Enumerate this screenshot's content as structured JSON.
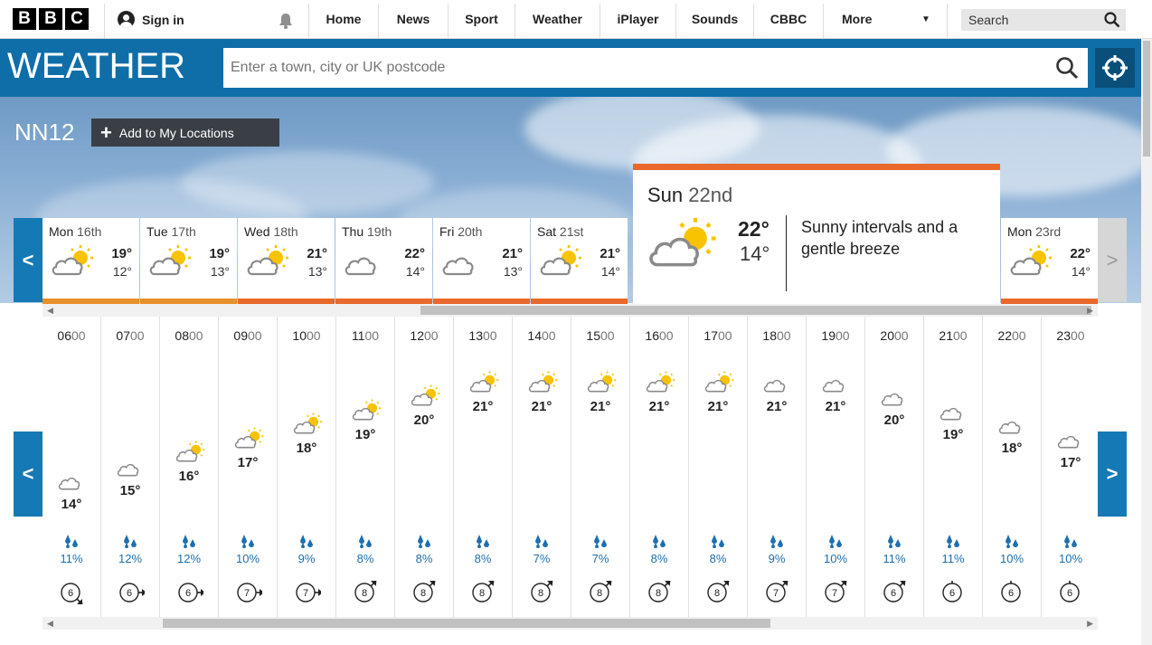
{
  "nav": {
    "logo_letters": [
      "B",
      "B",
      "C"
    ],
    "signin": "Sign in",
    "items": [
      "Home",
      "News",
      "Sport",
      "Weather",
      "iPlayer",
      "Sounds",
      "CBBC",
      "More"
    ],
    "search_placeholder": "Search"
  },
  "weather": {
    "title": "WEATHER",
    "search_placeholder": "Enter a town, city or UK postcode",
    "location": "NN12",
    "add_location": "Add to My Locations"
  },
  "days": [
    {
      "day": "Mon",
      "date": "16th",
      "hi": "19°",
      "lo": "12°",
      "icon": "sunny-intervals-icon"
    },
    {
      "day": "Tue",
      "date": "17th",
      "hi": "19°",
      "lo": "13°",
      "icon": "sunny-intervals-icon"
    },
    {
      "day": "Wed",
      "date": "18th",
      "hi": "21°",
      "lo": "13°",
      "icon": "sunny-intervals-icon"
    },
    {
      "day": "Thu",
      "date": "19th",
      "hi": "22°",
      "lo": "14°",
      "icon": "cloud-icon"
    },
    {
      "day": "Fri",
      "date": "20th",
      "hi": "21°",
      "lo": "13°",
      "icon": "cloud-icon"
    },
    {
      "day": "Sat",
      "date": "21st",
      "hi": "21°",
      "lo": "14°",
      "icon": "sunny-intervals-icon"
    }
  ],
  "selected_day": {
    "day": "Sun",
    "date": "22nd",
    "hi": "22°",
    "lo": "14°",
    "description": "Sunny intervals and a gentle breeze"
  },
  "next_day": {
    "day": "Mon",
    "date": "23rd",
    "hi": "22°",
    "lo": "14°"
  },
  "hours": [
    {
      "hh": "06",
      "mm": "00",
      "temp": "14°",
      "icon": "cloud",
      "rain": "11%",
      "wind": "6",
      "dir": "se"
    },
    {
      "hh": "07",
      "mm": "00",
      "temp": "15°",
      "icon": "cloud",
      "rain": "12%",
      "wind": "6",
      "dir": "e"
    },
    {
      "hh": "08",
      "mm": "00",
      "temp": "16°",
      "icon": "sun",
      "rain": "12%",
      "wind": "6",
      "dir": "e"
    },
    {
      "hh": "09",
      "mm": "00",
      "temp": "17°",
      "icon": "sun",
      "rain": "10%",
      "wind": "7",
      "dir": "e"
    },
    {
      "hh": "10",
      "mm": "00",
      "temp": "18°",
      "icon": "sun",
      "rain": "9%",
      "wind": "7",
      "dir": "e"
    },
    {
      "hh": "11",
      "mm": "00",
      "temp": "19°",
      "icon": "sun",
      "rain": "8%",
      "wind": "8",
      "dir": "ne"
    },
    {
      "hh": "12",
      "mm": "00",
      "temp": "20°",
      "icon": "sun",
      "rain": "8%",
      "wind": "8",
      "dir": "ne"
    },
    {
      "hh": "13",
      "mm": "00",
      "temp": "21°",
      "icon": "sun",
      "rain": "8%",
      "wind": "8",
      "dir": "ne"
    },
    {
      "hh": "14",
      "mm": "00",
      "temp": "21°",
      "icon": "sun",
      "rain": "7%",
      "wind": "8",
      "dir": "ne"
    },
    {
      "hh": "15",
      "mm": "00",
      "temp": "21°",
      "icon": "sun",
      "rain": "7%",
      "wind": "8",
      "dir": "ne"
    },
    {
      "hh": "16",
      "mm": "00",
      "temp": "21°",
      "icon": "sun",
      "rain": "8%",
      "wind": "8",
      "dir": "ne"
    },
    {
      "hh": "17",
      "mm": "00",
      "temp": "21°",
      "icon": "sun",
      "rain": "8%",
      "wind": "8",
      "dir": "ne"
    },
    {
      "hh": "18",
      "mm": "00",
      "temp": "21°",
      "icon": "cloud",
      "rain": "9%",
      "wind": "7",
      "dir": "ne"
    },
    {
      "hh": "19",
      "mm": "00",
      "temp": "21°",
      "icon": "cloud",
      "rain": "10%",
      "wind": "7",
      "dir": "ne"
    },
    {
      "hh": "20",
      "mm": "00",
      "temp": "20°",
      "icon": "cloud",
      "rain": "11%",
      "wind": "6",
      "dir": "ne"
    },
    {
      "hh": "21",
      "mm": "00",
      "temp": "19°",
      "icon": "cloud",
      "rain": "11%",
      "wind": "6",
      "dir": "n"
    },
    {
      "hh": "22",
      "mm": "00",
      "temp": "18°",
      "icon": "cloud",
      "rain": "10%",
      "wind": "6",
      "dir": "n"
    },
    {
      "hh": "23",
      "mm": "00",
      "temp": "17°",
      "icon": "cloud",
      "rain": "10%",
      "wind": "6",
      "dir": "n"
    }
  ],
  "colors": {
    "brand_blue": "#0f6ea8",
    "accent_orange": "#e8692b",
    "sun_yellow": "#f8c300",
    "rain_blue": "#1d6fb0"
  }
}
